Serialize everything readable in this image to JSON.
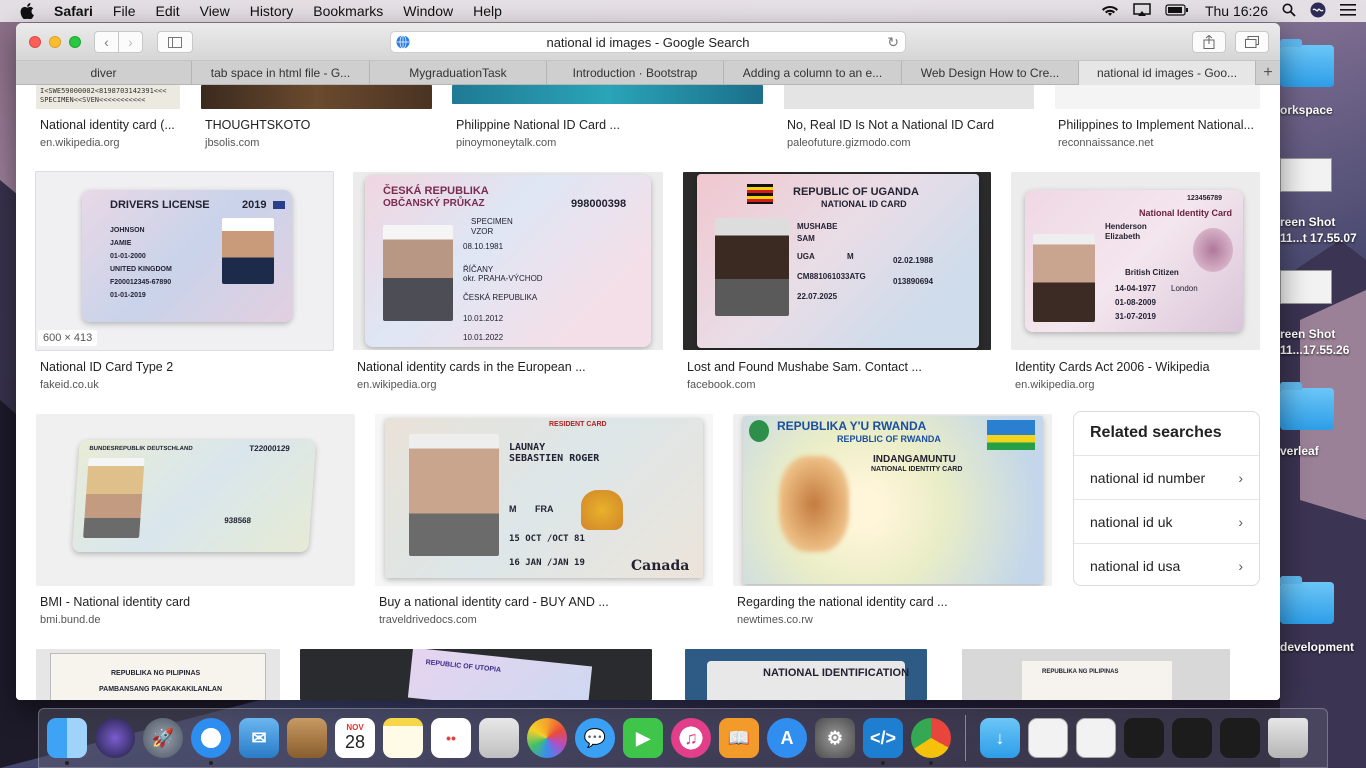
{
  "menubar": {
    "app_name": "Safari",
    "items": [
      "File",
      "Edit",
      "View",
      "History",
      "Bookmarks",
      "Window",
      "Help"
    ],
    "clock": "Thu 16:26",
    "status_icons": [
      "wifi-icon",
      "airplay-icon",
      "battery-icon",
      "spotlight-icon",
      "siri-icon",
      "notification-center-icon"
    ]
  },
  "browser": {
    "url_text": "national id images - Google Search",
    "tabs": [
      {
        "label": "diver"
      },
      {
        "label": "tab space in html file - G..."
      },
      {
        "label": "MygraduationTask"
      },
      {
        "label": "Introduction · Bootstrap"
      },
      {
        "label": "Adding a column to an e..."
      },
      {
        "label": "Web Design How to Cre..."
      },
      {
        "label": "national id images - Goo..."
      }
    ],
    "new_tab_label": "+"
  },
  "results_row1": [
    {
      "caption": "National identity card (...",
      "source": "en.wikipedia.org"
    },
    {
      "caption": "THOUGHTSKOTO",
      "source": "jbsolis.com"
    },
    {
      "caption": "Philippine National ID Card ...",
      "source": "pinoymoneytalk.com"
    },
    {
      "caption": "No, Real ID Is Not a National ID Card",
      "source": "paleofuture.gizmodo.com"
    },
    {
      "caption": "Philippines to Implement National...",
      "source": "reconnaissance.net"
    }
  ],
  "results_row2": [
    {
      "caption": "National ID Card Type 2",
      "source": "fakeid.co.uk",
      "dimensions": "600 × 413",
      "card_title": "DRIVERS LICENSE",
      "card_year": "2019",
      "card_lines": [
        "JOHNSON",
        "JAMIE",
        "01-01-2000",
        "UNITED KINGDOM",
        "F200012345-67890",
        "01-01-2019"
      ]
    },
    {
      "caption": "National identity cards in the European ...",
      "source": "en.wikipedia.org",
      "card_title": "ČESKÁ REPUBLIKA",
      "card_subtitle": "OBČANSKÝ PRŮKAZ",
      "card_number": "998000398",
      "card_lines": [
        "SPECIMEN",
        "VZOR",
        "08.10.1981",
        "ŘÍČANY",
        "okr. PRAHA-VÝCHOD",
        "ČESKÁ REPUBLIKA",
        "10.01.2012",
        "10.01.2022"
      ]
    },
    {
      "caption": "Lost and Found Mushabe Sam. Contact ...",
      "source": "facebook.com",
      "card_title": "REPUBLIC OF UGANDA",
      "card_subtitle": "NATIONAL ID CARD",
      "card_lines": [
        "MUSHABE",
        "SAM",
        "UGA",
        "M",
        "02.02.1988",
        "CM881061033ATG",
        "013890694",
        "22.07.2025"
      ]
    },
    {
      "caption": "Identity Cards Act 2006 - Wikipedia",
      "source": "en.wikipedia.org",
      "card_title": "National Identity Card",
      "card_number": "123456789",
      "card_lines": [
        "Henderson",
        "Elizabeth",
        "British Citizen",
        "14-04-1977",
        "London",
        "01-08-2009",
        "31-07-2019"
      ]
    }
  ],
  "results_row3": [
    {
      "caption": "BMI - National identity card",
      "source": "bmi.bund.de",
      "card_title": "BUNDESREPUBLIK DEUTSCHLAND",
      "card_number": "T22000129",
      "card_lines": [
        "938568"
      ]
    },
    {
      "caption": "Buy a national identity card - BUY AND ...",
      "source": "traveldrivedocs.com",
      "card_title": "RESIDENT CARD",
      "card_lines": [
        "LAUNAY",
        "SEBASTIEN ROGER",
        "M",
        "FRA",
        "15 OCT /OCT 81",
        "16 JAN /JAN 19",
        "Canada"
      ]
    },
    {
      "caption": "Regarding the national identity card ...",
      "source": "newtimes.co.rw",
      "card_title": "REPUBLIKA Y'U RWANDA",
      "card_subtitle": "REPUBLIC OF RWANDA",
      "card_lines": [
        "INDANGAMUNTU",
        "NATIONAL IDENTITY CARD"
      ]
    }
  ],
  "results_row4": [
    {
      "card_title": "REPUBLIKA NG PILIPINAS",
      "card_subtitle": "PAMBANSANG PAGKAKAKILANLAN"
    },
    {
      "card_title": "REPUBLIC OF UTOPIA"
    },
    {
      "card_title": "NATIONAL IDENTIFICATION"
    },
    {
      "card_title": "REPUBLIKA NG PILIPINAS"
    }
  ],
  "related_searches": {
    "heading": "Related searches",
    "items": [
      "national id number",
      "national id uk",
      "national id usa"
    ]
  },
  "desktop": {
    "labels": [
      "orkspace",
      "reen Shot",
      "11...t 17.55.07",
      "reen Shot",
      "11...17.55.26",
      "verleaf",
      "development"
    ]
  },
  "dock": {
    "calendar_month": "NOV",
    "calendar_day": "28"
  }
}
